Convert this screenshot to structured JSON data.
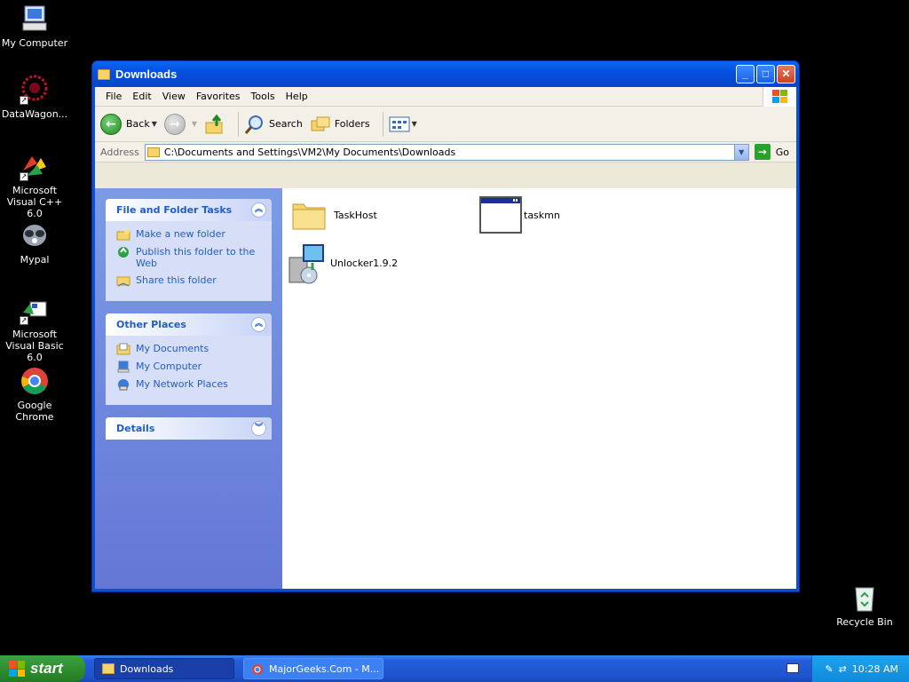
{
  "desktop": {
    "icons": [
      {
        "label": "My Computer"
      },
      {
        "label": "DataWagon..."
      },
      {
        "label": "Microsoft Visual C++ 6.0"
      },
      {
        "label": "Mypal"
      },
      {
        "label": "Microsoft Visual Basic 6.0"
      },
      {
        "label": "Google Chrome"
      },
      {
        "label": "Recycle Bin"
      }
    ]
  },
  "window": {
    "title": "Downloads",
    "menu": [
      "File",
      "Edit",
      "View",
      "Favorites",
      "Tools",
      "Help"
    ],
    "toolbar": {
      "back": "Back",
      "search": "Search",
      "folders": "Folders"
    },
    "address": {
      "label": "Address",
      "value": "C:\\Documents and Settings\\VM2\\My Documents\\Downloads",
      "go": "Go"
    },
    "tasks_panel": {
      "title": "File and Folder Tasks",
      "links": [
        "Make a new folder",
        "Publish this folder to the Web",
        "Share this folder"
      ]
    },
    "places_panel": {
      "title": "Other Places",
      "links": [
        "My Documents",
        "My Computer",
        "My Network Places"
      ]
    },
    "details_panel": {
      "title": "Details"
    },
    "files": [
      {
        "name": "TaskHost",
        "type": "folder"
      },
      {
        "name": "taskmn",
        "type": "application"
      },
      {
        "name": "Unlocker1.9.2",
        "type": "installer"
      }
    ]
  },
  "taskbar": {
    "start": "start",
    "buttons": [
      "Downloads",
      "MajorGeeks.Com - M..."
    ],
    "clock": "10:28 AM"
  }
}
